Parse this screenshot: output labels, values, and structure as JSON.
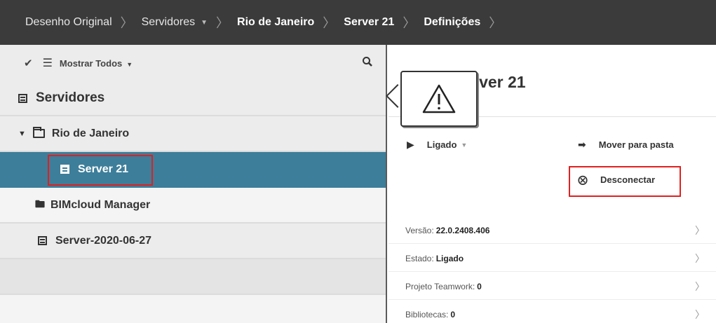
{
  "breadcrumb": [
    {
      "label": "Desenho Original",
      "bold": false,
      "dropdown": false
    },
    {
      "label": "Servidores",
      "bold": false,
      "dropdown": true
    },
    {
      "label": "Rio de Janeiro",
      "bold": true,
      "dropdown": false
    },
    {
      "label": "Server 21",
      "bold": true,
      "dropdown": false
    },
    {
      "label": "Definições",
      "bold": true,
      "dropdown": false
    }
  ],
  "toolbar": {
    "filter_label": "Mostrar Todos"
  },
  "sidebar": {
    "header": "Servidores",
    "folder": "Rio de Janeiro",
    "selected_item": "Server 21",
    "items": [
      "BIMcloud Manager",
      "Server-2020-06-27"
    ]
  },
  "content": {
    "title": "Server 21",
    "status_label": "Ligado",
    "move_label": "Mover para pasta",
    "disconnect_label": "Desconectar",
    "properties": [
      {
        "label": "Versão:",
        "value": "22.0.2408.406"
      },
      {
        "label": "Estado:",
        "value": "Ligado"
      },
      {
        "label": "Projeto Teamwork:",
        "value": "0"
      },
      {
        "label": "Bibliotecas:",
        "value": "0"
      }
    ]
  },
  "colors": {
    "topbar": "#3b3b3b",
    "selection": "#3d7e9a",
    "highlight": "#e02020",
    "sidebar": "#ececec"
  }
}
